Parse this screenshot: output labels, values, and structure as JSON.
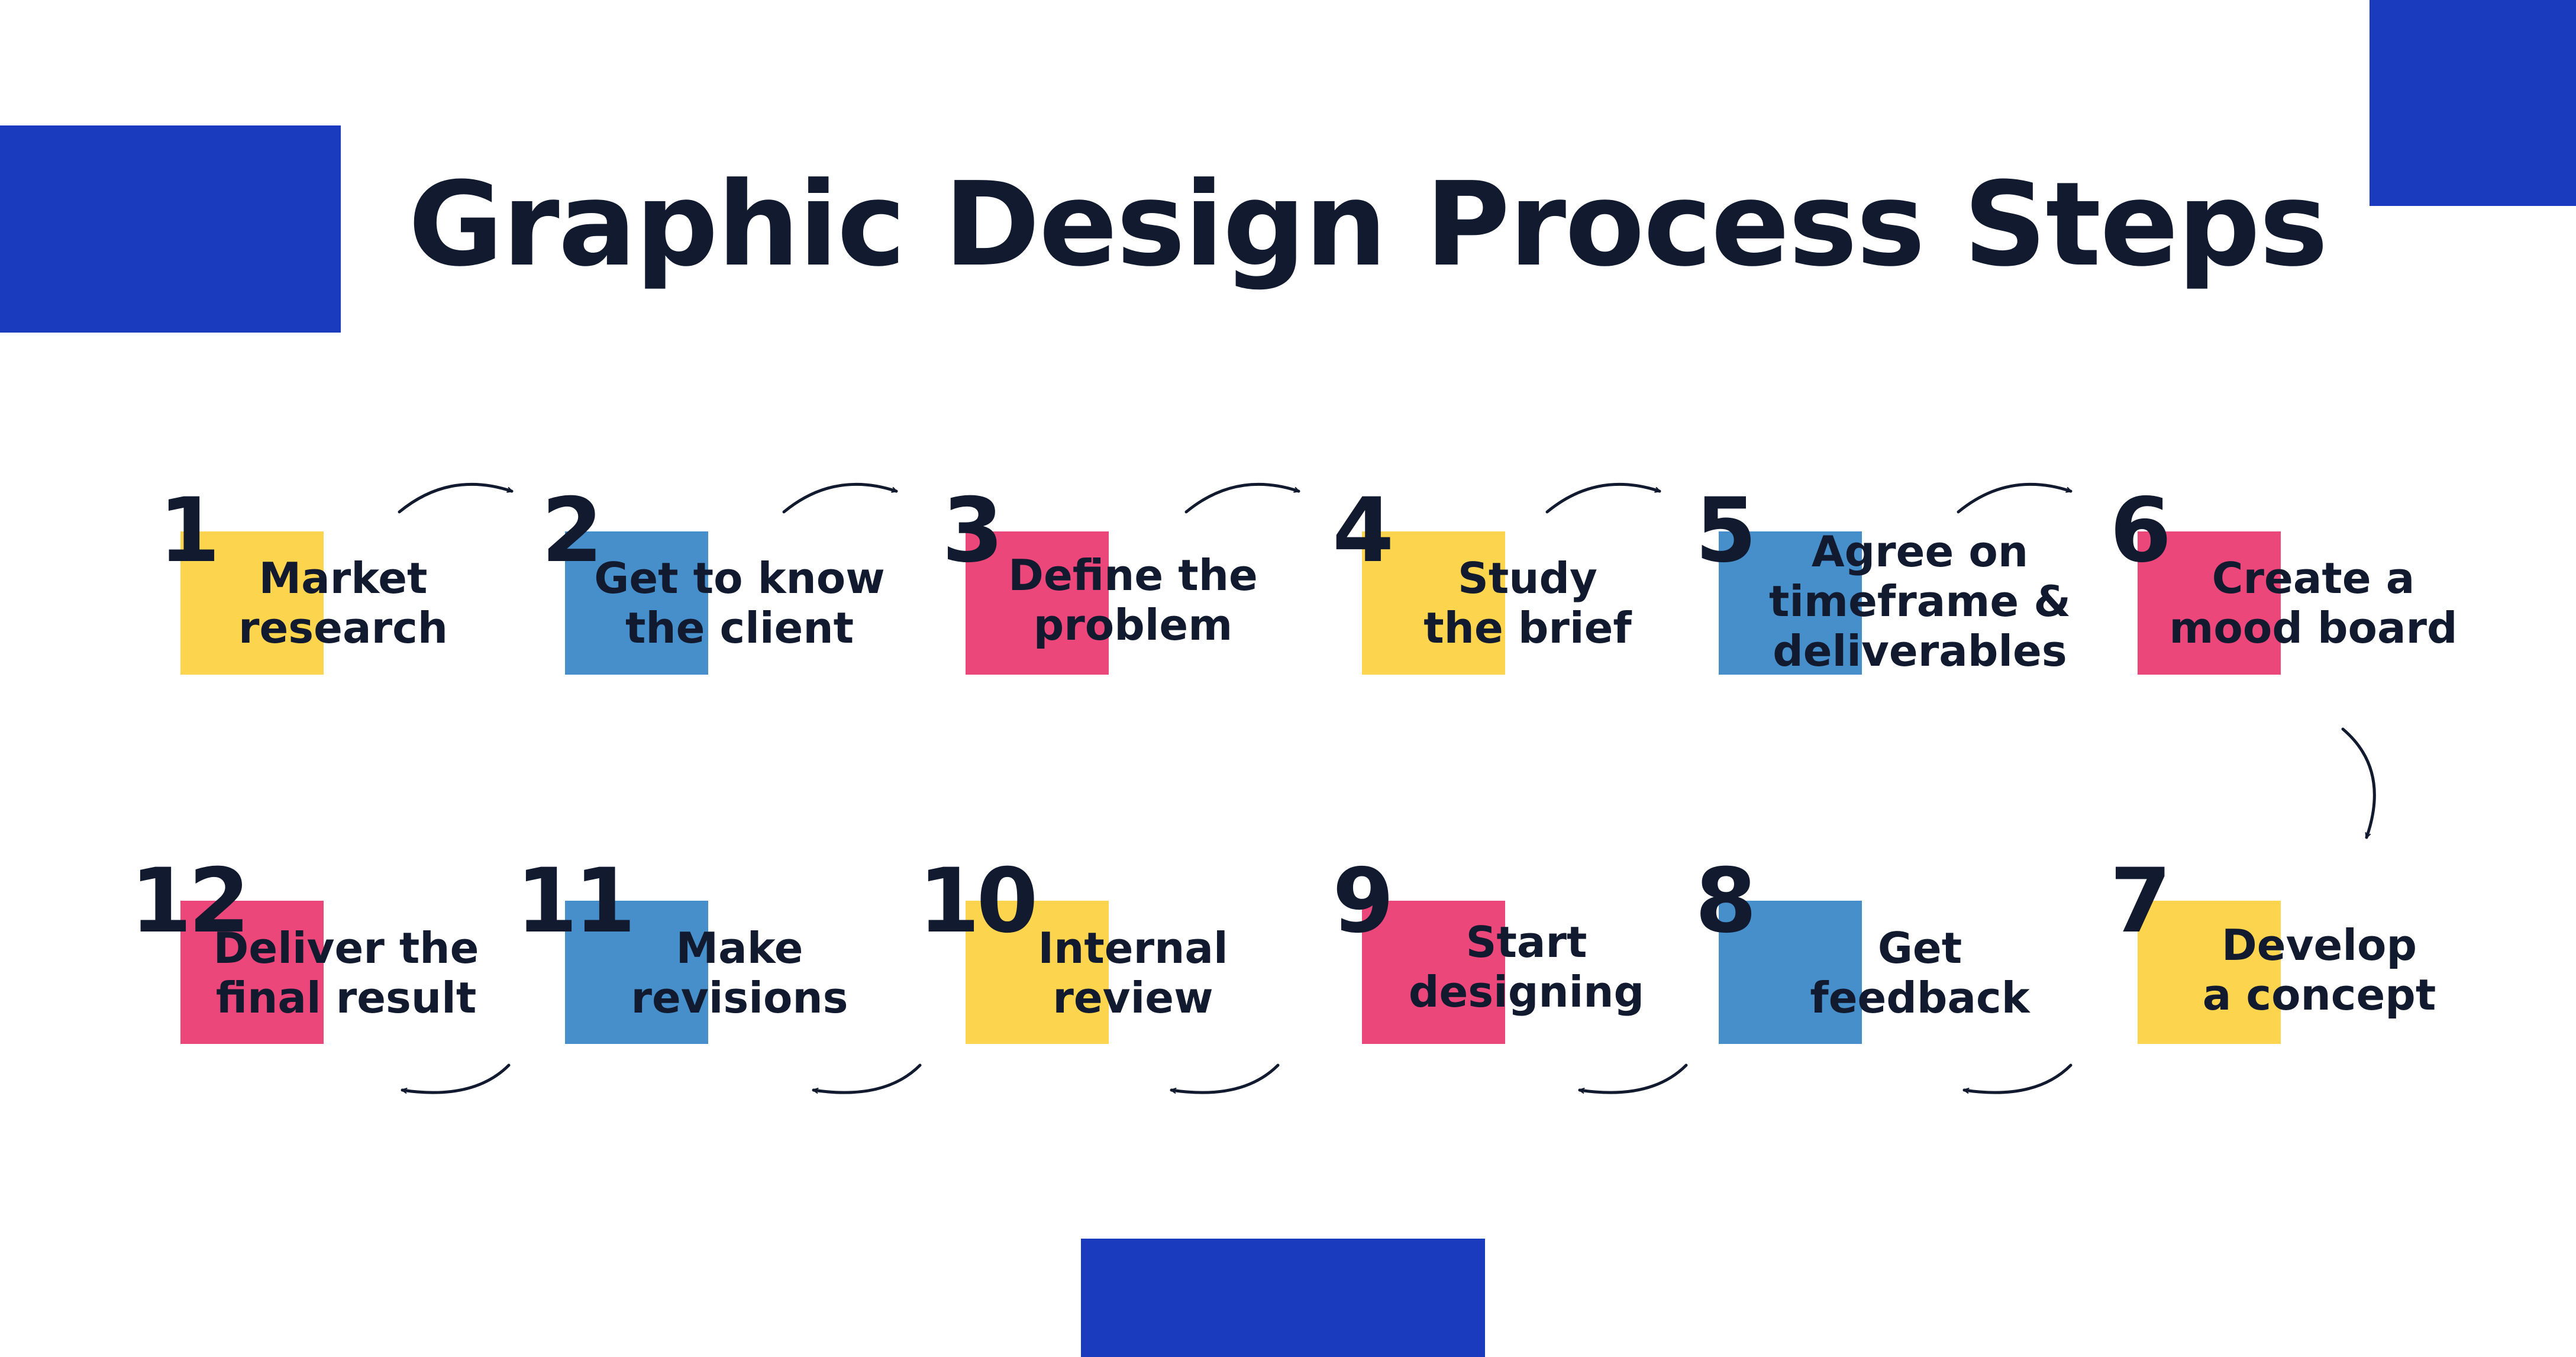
{
  "title": "Graphic Design Process Steps",
  "colors": {
    "accent_blue": "#1a3bbd",
    "yellow": "#fdd44e",
    "blue": "#468fcb",
    "pink": "#ec477b",
    "text": "#111a2e"
  },
  "steps": [
    {
      "number": "1",
      "label": "Market\nresearch",
      "color": "yellow"
    },
    {
      "number": "2",
      "label": "Get to know\nthe client",
      "color": "blue"
    },
    {
      "number": "3",
      "label": "Define the\nproblem",
      "color": "pink"
    },
    {
      "number": "4",
      "label": "Study\nthe brief",
      "color": "yellow"
    },
    {
      "number": "5",
      "label": "Agree on\ntimeframe &\ndeliverables",
      "color": "blue"
    },
    {
      "number": "6",
      "label": "Create a\nmood board",
      "color": "pink"
    },
    {
      "number": "7",
      "label": "Develop\na concept",
      "color": "yellow"
    },
    {
      "number": "8",
      "label": "Get\nfeedback",
      "color": "blue"
    },
    {
      "number": "9",
      "label": "Start\ndesigning",
      "color": "pink"
    },
    {
      "number": "10",
      "label": "Internal\nreview",
      "color": "yellow"
    },
    {
      "number": "11",
      "label": "Make\nrevisions",
      "color": "blue"
    },
    {
      "number": "12",
      "label": "Deliver the\nfinal result",
      "color": "pink"
    }
  ]
}
